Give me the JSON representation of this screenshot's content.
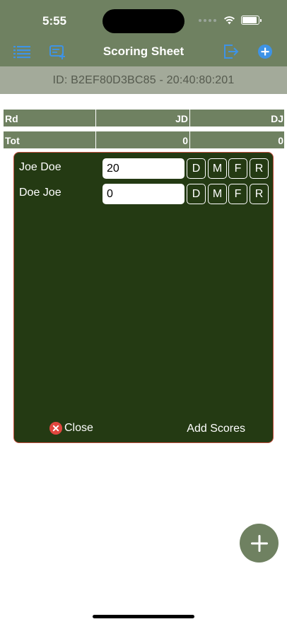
{
  "status": {
    "time": "5:55"
  },
  "nav": {
    "title": "Scoring Sheet"
  },
  "session": {
    "id_line": "ID:  B2EF80D3BC85 -  20:40:80:201"
  },
  "table": {
    "header": [
      "Rd",
      "JD",
      "DJ"
    ],
    "total": [
      "Tot",
      "0",
      "0"
    ]
  },
  "dialog": {
    "players": [
      {
        "name": "Joe Doe",
        "score": "20",
        "codes": [
          "D",
          "M",
          "F",
          "R"
        ]
      },
      {
        "name": "Doe Joe",
        "score": "0",
        "codes": [
          "D",
          "M",
          "F",
          "R"
        ]
      }
    ],
    "close_label": "Close",
    "add_scores_label": "Add Scores"
  },
  "colors": {
    "bar": "#6f8161",
    "dialog_bg": "#243a13",
    "dialog_border": "#c44d3c",
    "accent_blue": "#3e93e6",
    "close_red": "#e0473f"
  },
  "icons": {
    "left": [
      "list-icon",
      "add-sheet-icon"
    ],
    "right": [
      "export-icon",
      "add-circle-icon"
    ],
    "fab": "plus-icon"
  }
}
